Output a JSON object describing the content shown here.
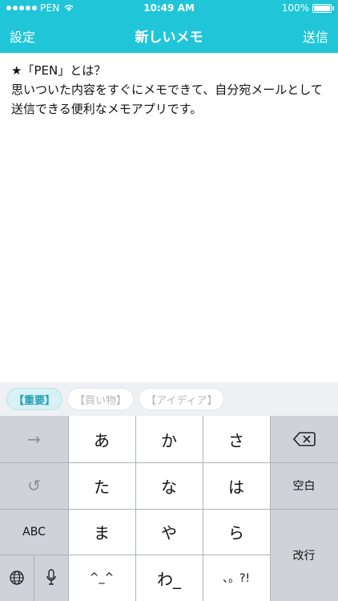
{
  "status": {
    "carrier": "PEN",
    "time": "10:49 AM",
    "battery": "100%"
  },
  "nav": {
    "left": "設定",
    "title": "新しいメモ",
    "right": "送信"
  },
  "note": {
    "line1": "★「PEN」とは？",
    "line2": "思いついた内容をすぐにメモできて、自分宛メールとして送信できる便利なメモアプリです。"
  },
  "tags": [
    "【重要】",
    "【買い物】",
    "【アイディア】"
  ],
  "keyboard": {
    "keys": {
      "next": "→",
      "undo": "↺",
      "abc": "ABC",
      "a": "あ",
      "ka": "か",
      "sa": "さ",
      "ta": "た",
      "na": "な",
      "ha": "は",
      "ma": "ま",
      "ya": "や",
      "ra": "ら",
      "caps": "^_^",
      "wa": "わ_",
      "punct": "、。?!",
      "space": "空白",
      "enter": "改行"
    }
  }
}
